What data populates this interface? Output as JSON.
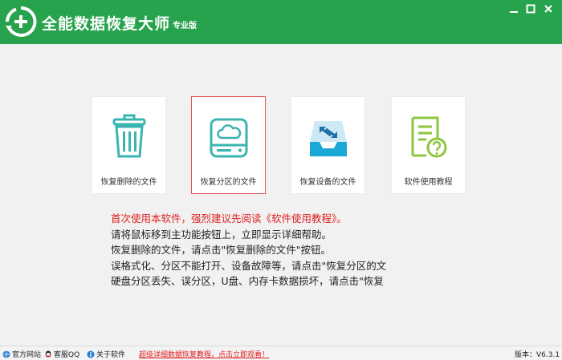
{
  "app": {
    "title": "全能数据恢复大师",
    "edition": "专业版"
  },
  "window_controls": [
    "minimize",
    "maximize",
    "close"
  ],
  "main": {
    "tiles": [
      {
        "label": "恢复删除的文件",
        "icon": "trash-icon"
      },
      {
        "label": "恢复分区的文件",
        "icon": "drive-icon",
        "selected": true
      },
      {
        "label": "恢复设备的文件",
        "icon": "device-tray-icon"
      },
      {
        "label": "软件使用教程",
        "icon": "help-document-icon"
      }
    ]
  },
  "help_text": [
    "首次使用本软件，强烈建议先阅读《软件使用教程》。",
    "请将鼠标移到主功能按钮上，立即显示详细帮助。",
    "恢复删除的文件，请点击\"恢复删除的文件\"按钮。",
    "误格式化、分区不能打开、设备故障等，请点击\"恢复分区的文",
    "硬盘分区丢失、误分区，U盘、内存卡数据损坏，请点击\"恢复"
  ],
  "statusbar": {
    "official_site": "官方网站",
    "support_qq": "客服QQ",
    "about": "关于软件",
    "promo": "超级详细数据恢复教程，点击立即观看！",
    "version_label": "版本：",
    "version": "V6.3.1"
  },
  "colors": {
    "brand_green": "#27a34d",
    "icon_teal": "#3ab4b0",
    "icon_blue": "#1aa8d6",
    "icon_yellowgreen": "#8dc63f",
    "selected_border": "#e25252",
    "warning_red": "#e02020"
  }
}
